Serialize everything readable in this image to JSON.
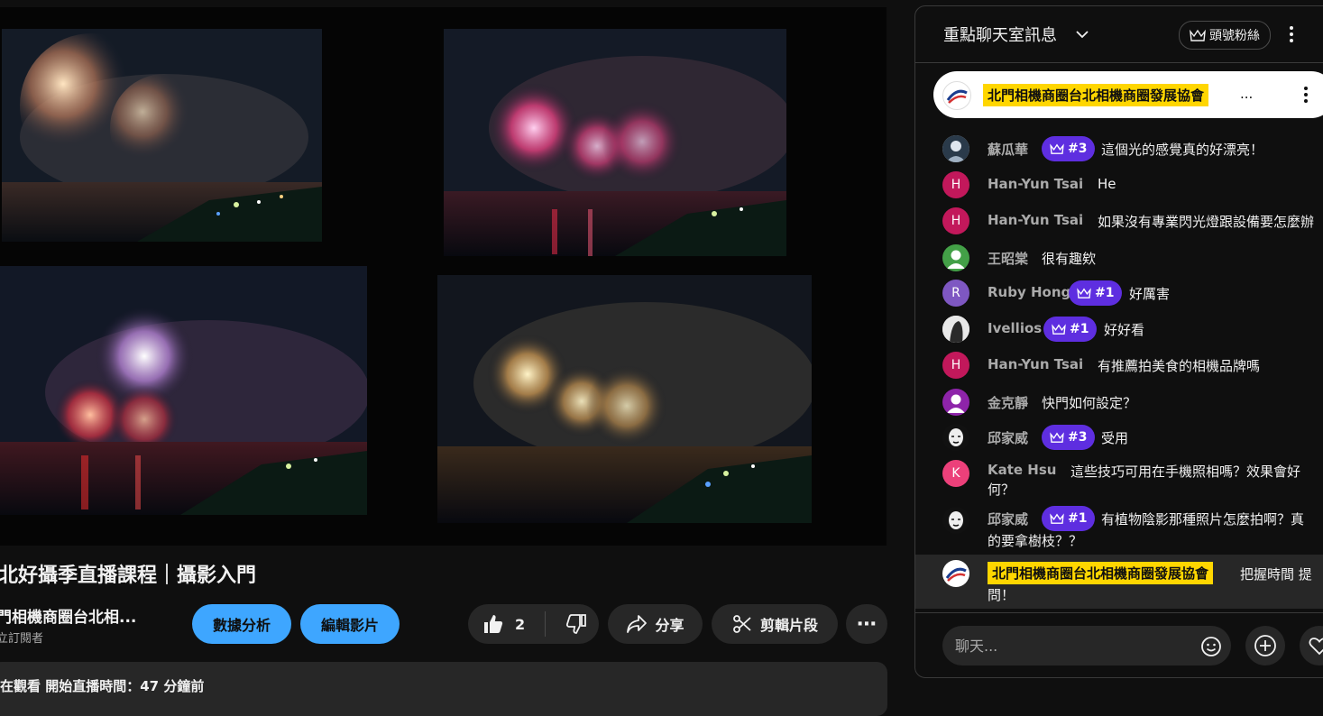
{
  "video": {
    "title": "北好攝季直播課程｜攝影入門",
    "channel_name": "門相機商圈台北相...",
    "subscribers": "立訂閱者",
    "buttons": {
      "analytics": "數據分析",
      "edit": "編輯影片",
      "like_count": "2",
      "share": "分享",
      "clip": "剪輯片段",
      "more": "⋯"
    },
    "description": "在觀看  開始直播時間：47 分鐘前"
  },
  "chat": {
    "header_title": "重點聊天室訊息",
    "fans_button": "頭號粉絲",
    "pinned": {
      "author": "北門相機商圈台北相機商圈發展協會",
      "text": "..."
    },
    "messages": [
      {
        "author": "蘇瓜華",
        "badge": "#3",
        "text": "這個光的感覺真的好漂亮！",
        "avatar": ""
      },
      {
        "author": "Han-Yun Tsai",
        "text": "He",
        "avatar": "H"
      },
      {
        "author": "Han-Yun Tsai",
        "text": "如果沒有專業閃光燈跟設備要怎麼辦",
        "avatar": "H"
      },
      {
        "author": "王昭棠",
        "text": "很有趣欸",
        "avatar": ""
      },
      {
        "author": "Ruby Hong",
        "badge": "#1",
        "text": "好厲害",
        "avatar": "R"
      },
      {
        "author": "Ivellios",
        "badge": "#1",
        "text": "好好看",
        "avatar": ""
      },
      {
        "author": "Han-Yun Tsai",
        "text": "有推薦拍美食的相機品牌嗎",
        "avatar": "H"
      },
      {
        "author": "金克靜",
        "text": "快門如何設定？",
        "avatar": ""
      },
      {
        "author": "邱家威",
        "badge": "#3",
        "text": "受用",
        "avatar": ""
      },
      {
        "author": "Kate Hsu",
        "text_line1": "這些技巧可用在手機照相嗎？效果會好",
        "text_line2": "何？",
        "avatar": "K"
      },
      {
        "author": "邱家威",
        "badge": "#1",
        "text_line1": "有植物陰影那種照片怎麼拍啊？真",
        "text_line2": "的要拿樹枝？？",
        "avatar": ""
      },
      {
        "author": "北門相機商圈台北相機商圈發展協會",
        "text_line1": "把握時間 提",
        "text_line2": "問！",
        "avatar": ""
      }
    ],
    "input_placeholder": "聊天..."
  },
  "colors": {
    "accent_blue": "#3ea6ff",
    "member_badge": "#5e2ee0",
    "owner_highlight": "#ffd600",
    "avatar_red": "#c2185b",
    "avatar_green": "#43a047",
    "avatar_purple": "#7e57c2",
    "avatar_pink": "#ec407a",
    "avatar_violet": "#8e24aa"
  }
}
